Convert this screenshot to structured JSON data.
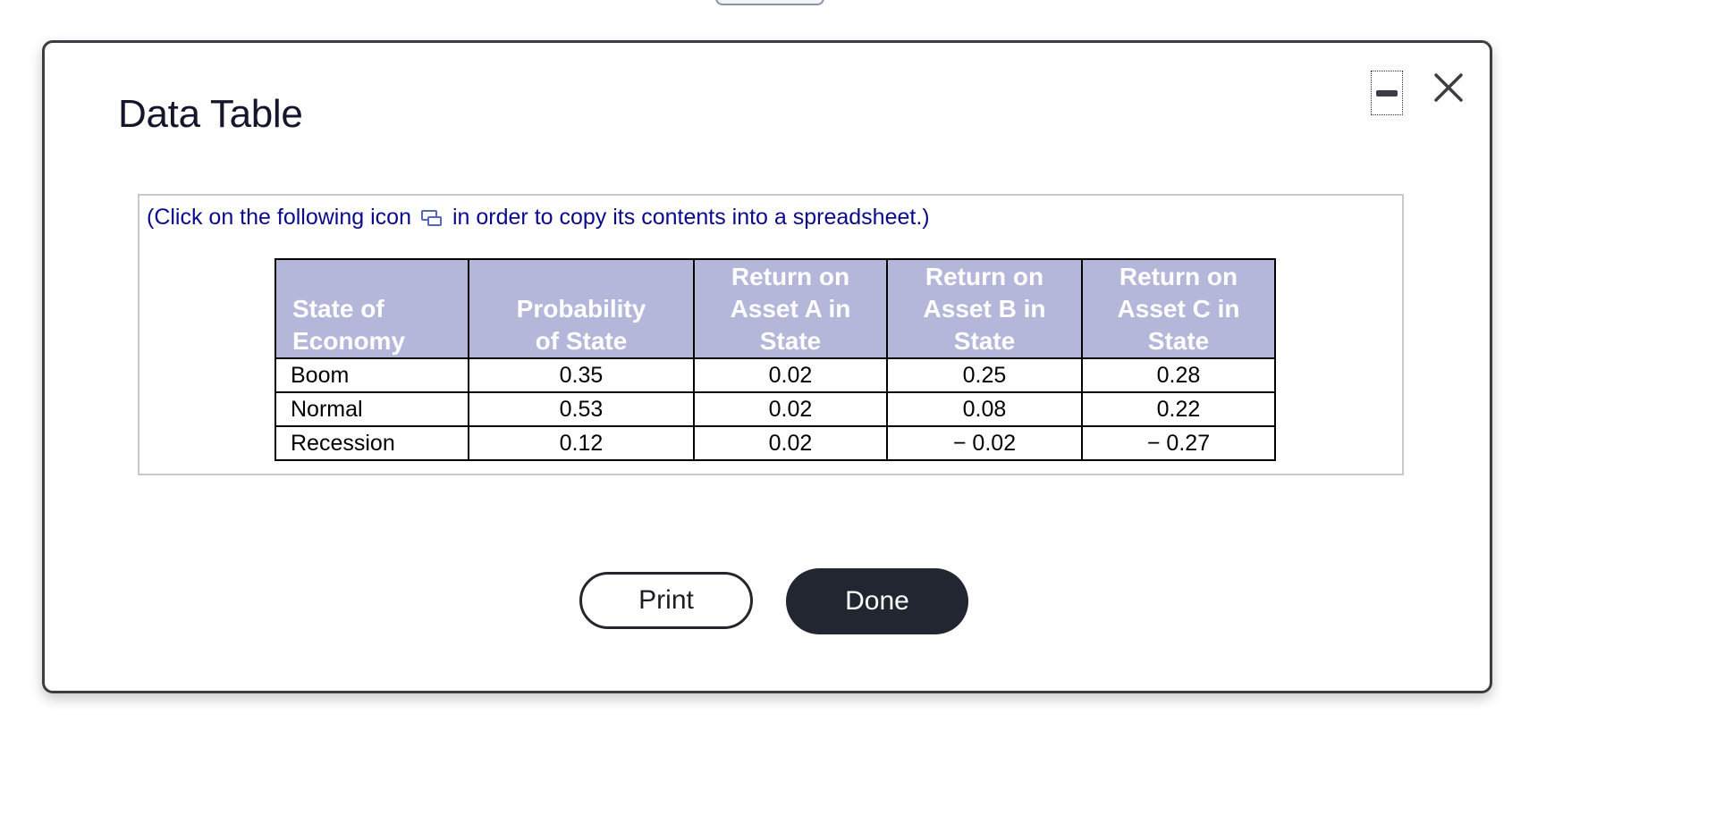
{
  "dialog": {
    "title": "Data Table",
    "instruction_before": "(Click on the following icon",
    "instruction_after": "in order to copy its contents into a spreadsheet.)"
  },
  "table": {
    "headers": [
      [
        "State of",
        "Economy"
      ],
      [
        "Probability",
        "of State"
      ],
      [
        "Return on",
        "Asset A in",
        "State"
      ],
      [
        "Return on",
        "Asset B in",
        "State"
      ],
      [
        "Return on",
        "Asset C in",
        "State"
      ]
    ],
    "rows": [
      [
        "Boom",
        "0.35",
        "0.02",
        "0.25",
        "0.28"
      ],
      [
        "Normal",
        "0.53",
        "0.02",
        "0.08",
        "0.22"
      ],
      [
        "Recession",
        "0.12",
        "0.02",
        "− 0.02",
        "− 0.27"
      ]
    ]
  },
  "buttons": {
    "print": "Print",
    "done": "Done"
  },
  "icons": {
    "copy": "copy-to-spreadsheet-icon",
    "minimize": "minimize-icon",
    "close": "close-icon"
  },
  "colors": {
    "header_bg": "#b4b6da",
    "instruction_text": "#0a0a8a",
    "done_button_bg": "#222631"
  }
}
